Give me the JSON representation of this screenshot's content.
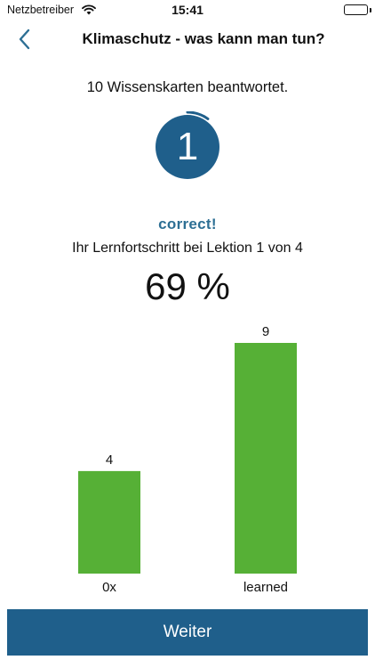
{
  "status_bar": {
    "carrier": "Netzbetreiber",
    "time": "15:41"
  },
  "nav": {
    "title": "Klimaschutz - was kann man tun?",
    "back_icon": "chevron-left-icon"
  },
  "summary": {
    "answered_text": "10 Wissenskarten beantwortet.",
    "card_number": "1",
    "ring_progress": 0.1,
    "result_text": "correct!",
    "lesson_text": "Ihr Lernfortschritt bei Lektion 1 von 4",
    "percent_text": "69 %"
  },
  "chart_data": {
    "type": "bar",
    "categories": [
      "0x",
      "learned"
    ],
    "values": [
      4,
      9
    ],
    "ylim": [
      0,
      9
    ],
    "grid": false,
    "color": "#56b036"
  },
  "colors": {
    "accent": "#1f5f8b",
    "result": "#2d6f94",
    "bar": "#56b036"
  },
  "footer": {
    "button_label": "Weiter"
  }
}
